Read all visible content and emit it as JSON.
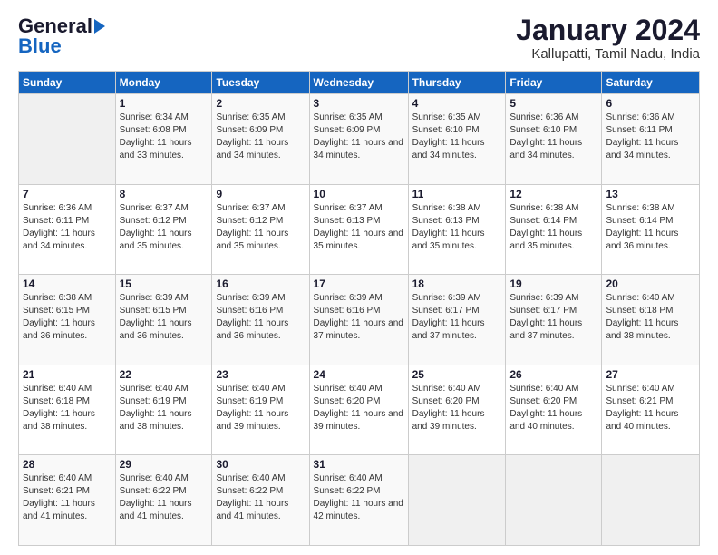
{
  "logo": {
    "general": "General",
    "blue": "Blue"
  },
  "title": "January 2024",
  "subtitle": "Kallupatti, Tamil Nadu, India",
  "headers": [
    "Sunday",
    "Monday",
    "Tuesday",
    "Wednesday",
    "Thursday",
    "Friday",
    "Saturday"
  ],
  "weeks": [
    [
      {
        "day": "",
        "sunrise": "",
        "sunset": "",
        "daylight": ""
      },
      {
        "day": "1",
        "sunrise": "Sunrise: 6:34 AM",
        "sunset": "Sunset: 6:08 PM",
        "daylight": "Daylight: 11 hours and 33 minutes."
      },
      {
        "day": "2",
        "sunrise": "Sunrise: 6:35 AM",
        "sunset": "Sunset: 6:09 PM",
        "daylight": "Daylight: 11 hours and 34 minutes."
      },
      {
        "day": "3",
        "sunrise": "Sunrise: 6:35 AM",
        "sunset": "Sunset: 6:09 PM",
        "daylight": "Daylight: 11 hours and 34 minutes."
      },
      {
        "day": "4",
        "sunrise": "Sunrise: 6:35 AM",
        "sunset": "Sunset: 6:10 PM",
        "daylight": "Daylight: 11 hours and 34 minutes."
      },
      {
        "day": "5",
        "sunrise": "Sunrise: 6:36 AM",
        "sunset": "Sunset: 6:10 PM",
        "daylight": "Daylight: 11 hours and 34 minutes."
      },
      {
        "day": "6",
        "sunrise": "Sunrise: 6:36 AM",
        "sunset": "Sunset: 6:11 PM",
        "daylight": "Daylight: 11 hours and 34 minutes."
      }
    ],
    [
      {
        "day": "7",
        "sunrise": "Sunrise: 6:36 AM",
        "sunset": "Sunset: 6:11 PM",
        "daylight": "Daylight: 11 hours and 34 minutes."
      },
      {
        "day": "8",
        "sunrise": "Sunrise: 6:37 AM",
        "sunset": "Sunset: 6:12 PM",
        "daylight": "Daylight: 11 hours and 35 minutes."
      },
      {
        "day": "9",
        "sunrise": "Sunrise: 6:37 AM",
        "sunset": "Sunset: 6:12 PM",
        "daylight": "Daylight: 11 hours and 35 minutes."
      },
      {
        "day": "10",
        "sunrise": "Sunrise: 6:37 AM",
        "sunset": "Sunset: 6:13 PM",
        "daylight": "Daylight: 11 hours and 35 minutes."
      },
      {
        "day": "11",
        "sunrise": "Sunrise: 6:38 AM",
        "sunset": "Sunset: 6:13 PM",
        "daylight": "Daylight: 11 hours and 35 minutes."
      },
      {
        "day": "12",
        "sunrise": "Sunrise: 6:38 AM",
        "sunset": "Sunset: 6:14 PM",
        "daylight": "Daylight: 11 hours and 35 minutes."
      },
      {
        "day": "13",
        "sunrise": "Sunrise: 6:38 AM",
        "sunset": "Sunset: 6:14 PM",
        "daylight": "Daylight: 11 hours and 36 minutes."
      }
    ],
    [
      {
        "day": "14",
        "sunrise": "Sunrise: 6:38 AM",
        "sunset": "Sunset: 6:15 PM",
        "daylight": "Daylight: 11 hours and 36 minutes."
      },
      {
        "day": "15",
        "sunrise": "Sunrise: 6:39 AM",
        "sunset": "Sunset: 6:15 PM",
        "daylight": "Daylight: 11 hours and 36 minutes."
      },
      {
        "day": "16",
        "sunrise": "Sunrise: 6:39 AM",
        "sunset": "Sunset: 6:16 PM",
        "daylight": "Daylight: 11 hours and 36 minutes."
      },
      {
        "day": "17",
        "sunrise": "Sunrise: 6:39 AM",
        "sunset": "Sunset: 6:16 PM",
        "daylight": "Daylight: 11 hours and 37 minutes."
      },
      {
        "day": "18",
        "sunrise": "Sunrise: 6:39 AM",
        "sunset": "Sunset: 6:17 PM",
        "daylight": "Daylight: 11 hours and 37 minutes."
      },
      {
        "day": "19",
        "sunrise": "Sunrise: 6:39 AM",
        "sunset": "Sunset: 6:17 PM",
        "daylight": "Daylight: 11 hours and 37 minutes."
      },
      {
        "day": "20",
        "sunrise": "Sunrise: 6:40 AM",
        "sunset": "Sunset: 6:18 PM",
        "daylight": "Daylight: 11 hours and 38 minutes."
      }
    ],
    [
      {
        "day": "21",
        "sunrise": "Sunrise: 6:40 AM",
        "sunset": "Sunset: 6:18 PM",
        "daylight": "Daylight: 11 hours and 38 minutes."
      },
      {
        "day": "22",
        "sunrise": "Sunrise: 6:40 AM",
        "sunset": "Sunset: 6:19 PM",
        "daylight": "Daylight: 11 hours and 38 minutes."
      },
      {
        "day": "23",
        "sunrise": "Sunrise: 6:40 AM",
        "sunset": "Sunset: 6:19 PM",
        "daylight": "Daylight: 11 hours and 39 minutes."
      },
      {
        "day": "24",
        "sunrise": "Sunrise: 6:40 AM",
        "sunset": "Sunset: 6:20 PM",
        "daylight": "Daylight: 11 hours and 39 minutes."
      },
      {
        "day": "25",
        "sunrise": "Sunrise: 6:40 AM",
        "sunset": "Sunset: 6:20 PM",
        "daylight": "Daylight: 11 hours and 39 minutes."
      },
      {
        "day": "26",
        "sunrise": "Sunrise: 6:40 AM",
        "sunset": "Sunset: 6:20 PM",
        "daylight": "Daylight: 11 hours and 40 minutes."
      },
      {
        "day": "27",
        "sunrise": "Sunrise: 6:40 AM",
        "sunset": "Sunset: 6:21 PM",
        "daylight": "Daylight: 11 hours and 40 minutes."
      }
    ],
    [
      {
        "day": "28",
        "sunrise": "Sunrise: 6:40 AM",
        "sunset": "Sunset: 6:21 PM",
        "daylight": "Daylight: 11 hours and 41 minutes."
      },
      {
        "day": "29",
        "sunrise": "Sunrise: 6:40 AM",
        "sunset": "Sunset: 6:22 PM",
        "daylight": "Daylight: 11 hours and 41 minutes."
      },
      {
        "day": "30",
        "sunrise": "Sunrise: 6:40 AM",
        "sunset": "Sunset: 6:22 PM",
        "daylight": "Daylight: 11 hours and 41 minutes."
      },
      {
        "day": "31",
        "sunrise": "Sunrise: 6:40 AM",
        "sunset": "Sunset: 6:22 PM",
        "daylight": "Daylight: 11 hours and 42 minutes."
      },
      {
        "day": "",
        "sunrise": "",
        "sunset": "",
        "daylight": ""
      },
      {
        "day": "",
        "sunrise": "",
        "sunset": "",
        "daylight": ""
      },
      {
        "day": "",
        "sunrise": "",
        "sunset": "",
        "daylight": ""
      }
    ]
  ]
}
